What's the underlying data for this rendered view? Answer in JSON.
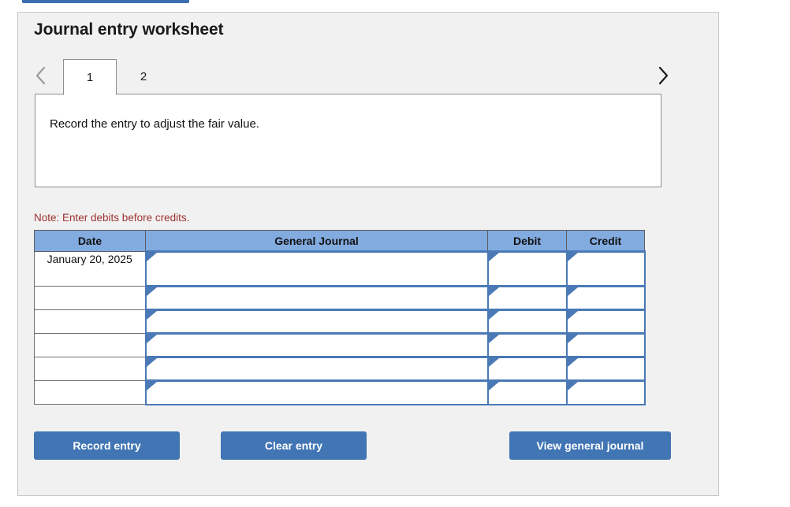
{
  "window": {
    "top_bar_accent": "#3a6fb0"
  },
  "panel": {
    "title": "Journal entry worksheet",
    "background": "#f1f1f1"
  },
  "pager": {
    "prev_icon": "chevron-left-icon",
    "next_icon": "chevron-right-icon",
    "prev_enabled": "false",
    "next_enabled": "true",
    "tabs": [
      {
        "label": "1",
        "active": "true"
      },
      {
        "label": "2",
        "active": "false"
      }
    ]
  },
  "prompt": {
    "text": "Record the entry to adjust the fair value."
  },
  "note": {
    "text": "Note: Enter debits before credits."
  },
  "table": {
    "header_color": "#82abe0",
    "columns": [
      "Date",
      "General Journal",
      "Debit",
      "Credit"
    ],
    "rows": [
      {
        "date": "January 20, 2025",
        "general_journal": "",
        "debit": "",
        "credit": ""
      },
      {
        "date": "",
        "general_journal": "",
        "debit": "",
        "credit": ""
      },
      {
        "date": "",
        "general_journal": "",
        "debit": "",
        "credit": ""
      },
      {
        "date": "",
        "general_journal": "",
        "debit": "",
        "credit": ""
      },
      {
        "date": "",
        "general_journal": "",
        "debit": "",
        "credit": ""
      },
      {
        "date": "",
        "general_journal": "",
        "debit": "",
        "credit": ""
      }
    ]
  },
  "actions": {
    "record_label": "Record entry",
    "clear_label": "Clear entry",
    "view_label": "View general journal",
    "button_color": "#4175b4"
  }
}
